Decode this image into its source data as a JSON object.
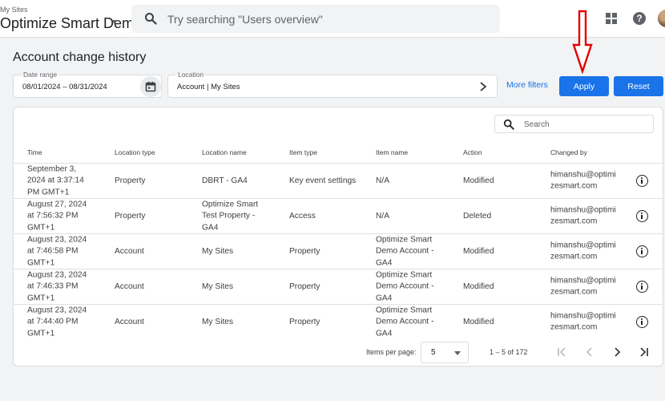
{
  "header": {
    "account_sub": "My Sites",
    "account_name": "Optimize Smart Demo Acco...",
    "search_placeholder": "Try searching \"Users overview\""
  },
  "page": {
    "title": "Account change history"
  },
  "filters": {
    "date_range_label": "Date range",
    "date_range_value": "08/01/2024 – 08/31/2024",
    "location_label": "Location",
    "location_value": "Account | My Sites",
    "more_filters": "More filters",
    "apply": "Apply",
    "reset": "Reset"
  },
  "annotation": {
    "arrow_color": "#e00000"
  },
  "table": {
    "search_placeholder": "Search",
    "columns": [
      "Time",
      "Location type",
      "Location name",
      "Item type",
      "Item name",
      "Action",
      "Changed by"
    ],
    "rows": [
      {
        "time": [
          "September 3,",
          "2024 at 3:37:14",
          "PM GMT+1"
        ],
        "location_type": "Property",
        "location_name": [
          "DBRT - GA4"
        ],
        "item_type": "Key event settings",
        "item_name": [
          "N/A"
        ],
        "action": "Modified",
        "changed_by": [
          "himanshu@optimi",
          "zesmart.com"
        ]
      },
      {
        "time": [
          "August 27, 2024",
          "at 7:56:32 PM",
          "GMT+1"
        ],
        "location_type": "Property",
        "location_name": [
          "Optimize Smart",
          "Test Property -",
          "GA4"
        ],
        "item_type": "Access",
        "item_name": [
          "N/A"
        ],
        "action": "Deleted",
        "changed_by": [
          "himanshu@optimi",
          "zesmart.com"
        ]
      },
      {
        "time": [
          "August 23, 2024",
          "at 7:46:58 PM",
          "GMT+1"
        ],
        "location_type": "Account",
        "location_name": [
          "My Sites"
        ],
        "item_type": "Property",
        "item_name": [
          "Optimize Smart",
          "Demo Account -",
          "GA4"
        ],
        "action": "Modified",
        "changed_by": [
          "himanshu@optimi",
          "zesmart.com"
        ]
      },
      {
        "time": [
          "August 23, 2024",
          "at 7:46:33 PM",
          "GMT+1"
        ],
        "location_type": "Account",
        "location_name": [
          "My Sites"
        ],
        "item_type": "Property",
        "item_name": [
          "Optimize Smart",
          "Demo Account -",
          "GA4"
        ],
        "action": "Modified",
        "changed_by": [
          "himanshu@optimi",
          "zesmart.com"
        ]
      },
      {
        "time": [
          "August 23, 2024",
          "at 7:44:40 PM",
          "GMT+1"
        ],
        "location_type": "Account",
        "location_name": [
          "My Sites"
        ],
        "item_type": "Property",
        "item_name": [
          "Optimize Smart",
          "Demo Account -",
          "GA4"
        ],
        "action": "Modified",
        "changed_by": [
          "himanshu@optimi",
          "zesmart.com"
        ]
      }
    ]
  },
  "paginator": {
    "items_per_page_label": "Items per page:",
    "items_per_page_value": "5",
    "range": "1 – 5 of 172"
  },
  "colors": {
    "primary": "#1a73e8",
    "background": "#f1f3f4"
  }
}
